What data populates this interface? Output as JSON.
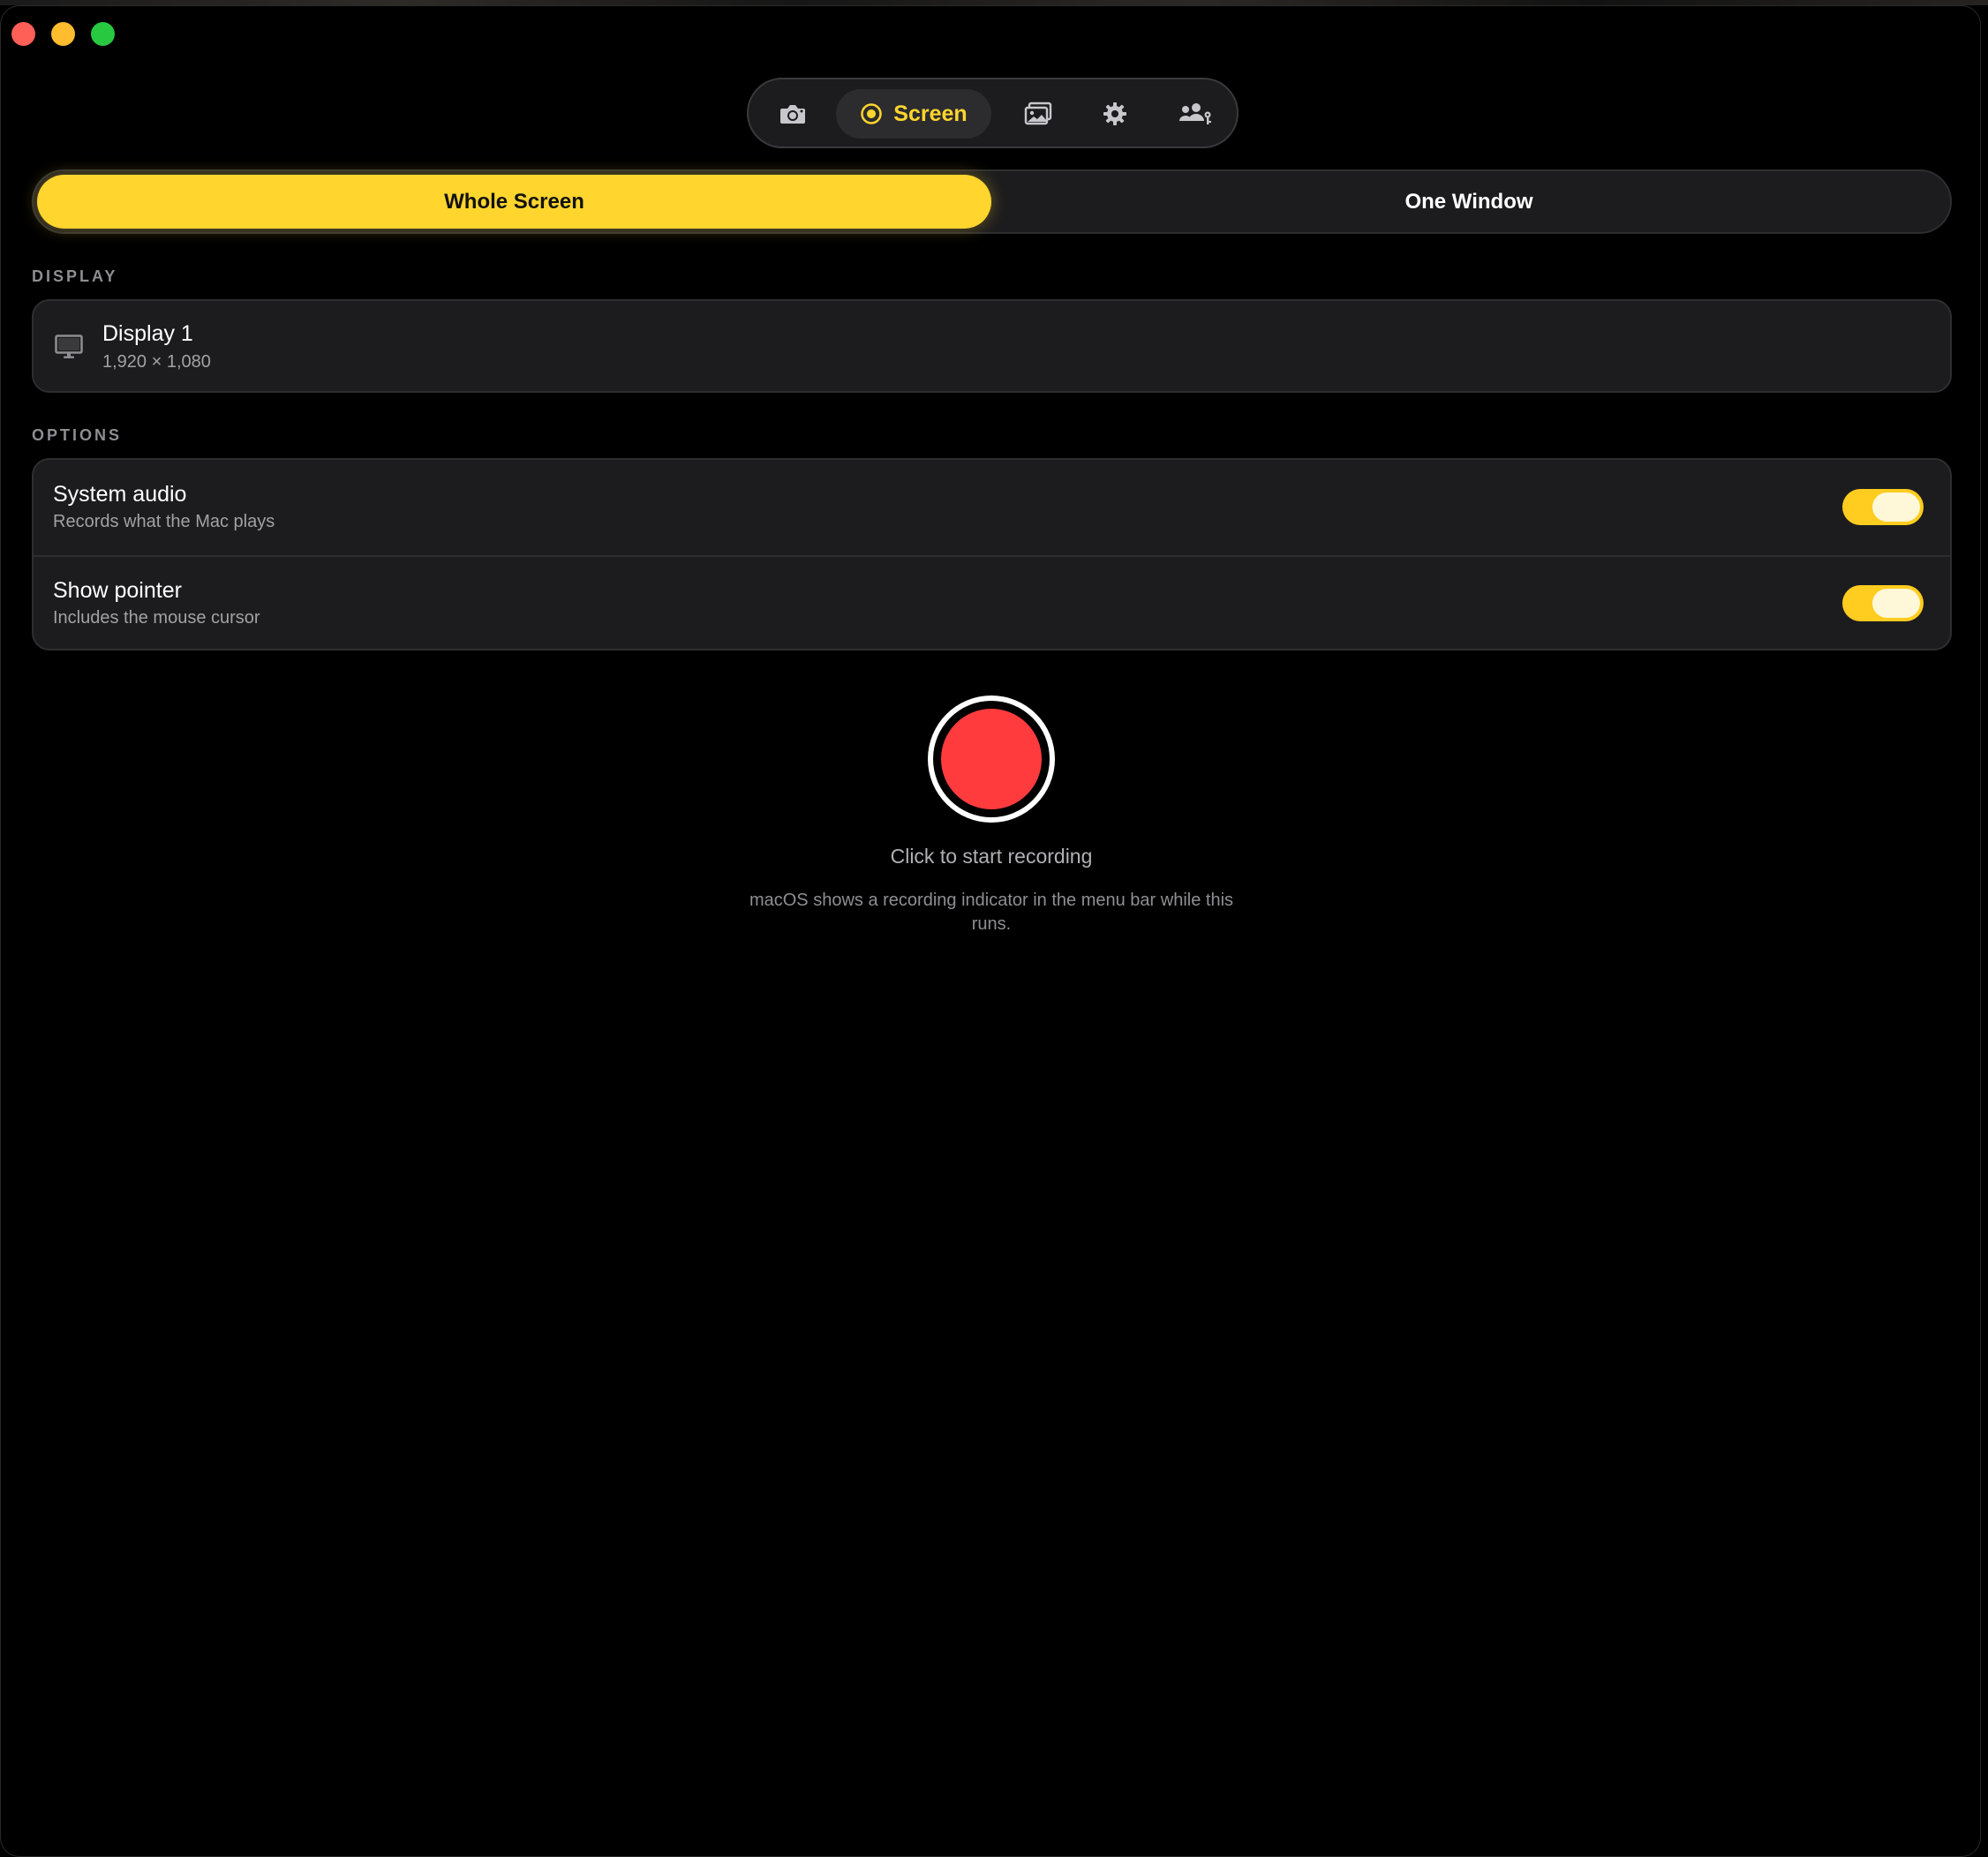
{
  "window": {
    "traffic_lights": [
      "close",
      "minimize",
      "zoom"
    ]
  },
  "toolbar": {
    "items": [
      {
        "icon": "camera-icon",
        "label": ""
      },
      {
        "icon": "record-circle-icon",
        "label": "Screen",
        "active": true
      },
      {
        "icon": "gallery-icon",
        "label": ""
      },
      {
        "icon": "gear-icon",
        "label": ""
      },
      {
        "icon": "people-key-icon",
        "label": ""
      }
    ],
    "active_label": "Screen",
    "accent": "#ffd52e"
  },
  "segment": {
    "options": [
      "Whole Screen",
      "One Window"
    ],
    "selected": "Whole Screen"
  },
  "display": {
    "section_label": "DISPLAY",
    "name": "Display 1",
    "resolution": "1,920 × 1,080",
    "icon": "monitor-icon"
  },
  "options": {
    "section_label": "OPTIONS",
    "items": [
      {
        "title": "System audio",
        "subtitle": "Records what the Mac plays",
        "enabled": true
      },
      {
        "title": "Show pointer",
        "subtitle": "Includes the mouse cursor",
        "enabled": true
      }
    ]
  },
  "record": {
    "caption": "Click to start recording",
    "note": "macOS shows a recording indicator in the menu bar while this runs.",
    "color": "#ff3b3e"
  }
}
